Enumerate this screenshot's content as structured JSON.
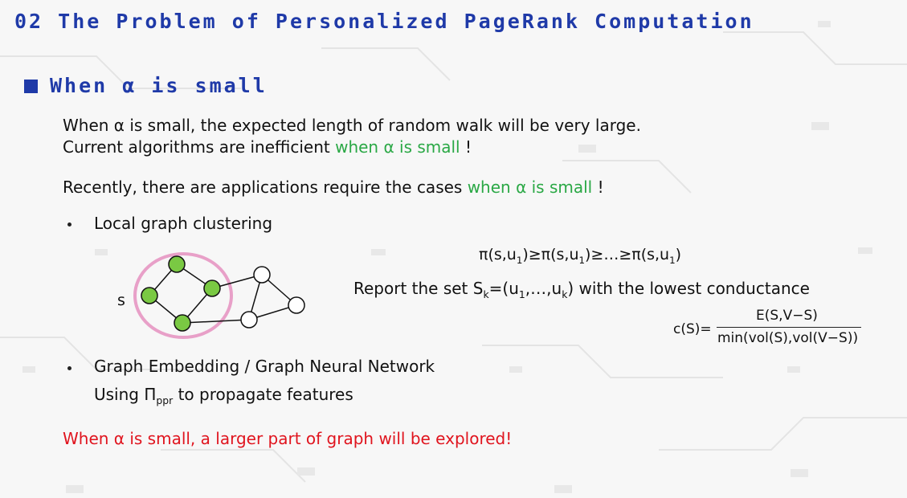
{
  "slide": {
    "title": "02 The Problem of Personalized PageRank Computation",
    "section": "When α is small",
    "para1": {
      "line1": "When α is small,  the expected length of random walk will be very large.",
      "line2_pre": "Current algorithms are inefficient ",
      "line2_hl": "when α is small",
      "line2_post": " !"
    },
    "para2": {
      "pre": "Recently, there are applications require the cases ",
      "hl": "when α is small",
      "post": " !"
    },
    "bullet1": {
      "label": "Local graph clustering",
      "ordering": {
        "pi": "π(s,u",
        "one": "1",
        "ge": ")≥π(s,u",
        "ell": ")≥…≥π(s,u",
        "close": ")"
      },
      "report": {
        "pre": "Report the set S",
        "k": "k",
        "mid": "=(u",
        "one": "1",
        "dots": ",…,u",
        "k2": "k",
        "post": ") with the lowest conductance"
      },
      "conductance": {
        "lhs": "c(S)=",
        "numerator": "E(S,V−S)",
        "denominator": "min(vol(S),vol(V−S))"
      },
      "graph_label": "s"
    },
    "bullet2": {
      "label": "Graph Embedding / Graph Neural Network",
      "sub_pre": "Using Π",
      "sub_sub": "ppr",
      "sub_post": " to propagate features"
    },
    "conclusion": "When α is small, a larger part of graph will be explored!"
  },
  "colors": {
    "title": "#1f3aa8",
    "highlight": "#2aa845",
    "warning": "#e0141e",
    "node_visited": "#7ac943",
    "cluster_ring": "#e8a0c8"
  }
}
